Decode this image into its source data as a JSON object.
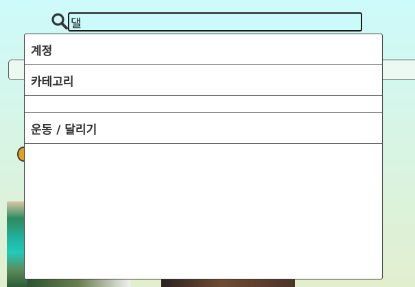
{
  "search": {
    "value": "댈",
    "icon": "search-icon"
  },
  "dropdown": {
    "header_account": "계정",
    "header_category": "카테고리",
    "option_sports_running": "운동 / 달리기"
  },
  "colors": {
    "background_top": "#cdfafa",
    "background_bottom": "#e2efce",
    "input_background": "#cbfafa",
    "dropdown_background": "#ffffff",
    "text": "#2e2e2e"
  }
}
